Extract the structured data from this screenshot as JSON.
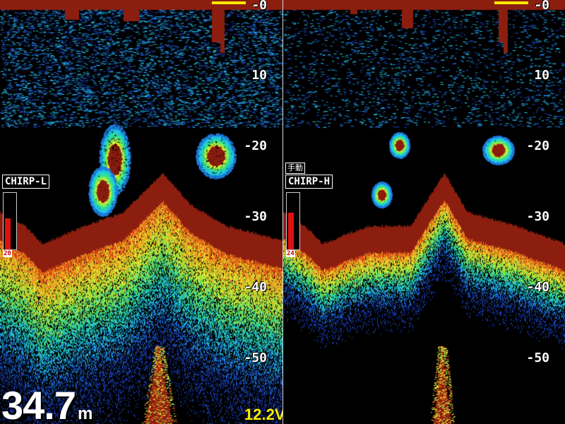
{
  "left_panel": {
    "mode_label": "CHIRP-L",
    "gain_value": "20",
    "gain_level": 0.55
  },
  "right_panel": {
    "mode_label": "CHIRP-H",
    "manual_label": "手動",
    "gain_value": "24",
    "gain_level": 0.65
  },
  "depth_scale": [
    "-0",
    "10",
    "-20",
    "-30",
    "-40",
    "-50"
  ],
  "readouts": {
    "depth_value": "34.7",
    "depth_unit": "m",
    "voltage": "12.2V"
  },
  "colors": {
    "bottom": "#8c1e10",
    "zero_marker": "#ffea00",
    "voltage": "#ffee00",
    "gain": "#e01010"
  }
}
